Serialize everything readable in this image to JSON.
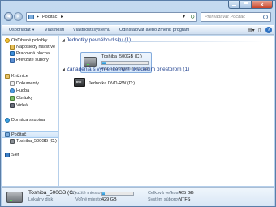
{
  "address": {
    "path_label": "Počítač"
  },
  "search": {
    "placeholder": "Prehľadávať Počítač"
  },
  "toolbar": {
    "organize_label": "Usporiadať",
    "properties_label": "Vlastnosti",
    "system_properties_label": "Vlastnosti systému",
    "uninstall_label": "Odinštalovať alebo zmeniť program"
  },
  "nav": {
    "favorites": {
      "header": "Obľúbené položky",
      "items": [
        "Naposledy navštíve",
        "Pracovná plocha",
        "Prevzaté súbory"
      ]
    },
    "libraries": {
      "header": "Knižnice",
      "items": [
        "Dokumenty",
        "Hudba",
        "Obrázky",
        "Videá"
      ]
    },
    "homegroup": "Domáca skupina",
    "computer": {
      "header": "Počítač",
      "items": [
        "Toshiba_500GB (C:)"
      ]
    },
    "network": "Sieť"
  },
  "content": {
    "hdd_group": "Jednotky pevného disku (1)",
    "removable_group": "Zariadenia s vymeniteľným ukladacím priestorom (1)",
    "drive_c": {
      "name": "Toshiba_500GB (C:)",
      "free_text": "429 GB voľných z 465 GB",
      "used_fraction": 0.077
    },
    "dvd": {
      "name": "Jednotka DVD-RW (D:)",
      "badge": "DVD"
    }
  },
  "details": {
    "name": "Toshiba_500GB (C:)",
    "type": "Lokálny disk",
    "used_label": "Využité miesto:",
    "free_label": "Voľné miesto:",
    "free_value": "429 GB",
    "total_label": "Celková veľkosť:",
    "total_value": "465 GB",
    "fs_label": "Systém súborov:",
    "fs_value": "NTFS"
  },
  "colors": {
    "accent": "#1e3f8e",
    "bar_fill": "#2592d6",
    "frame": "#b3cde9"
  }
}
